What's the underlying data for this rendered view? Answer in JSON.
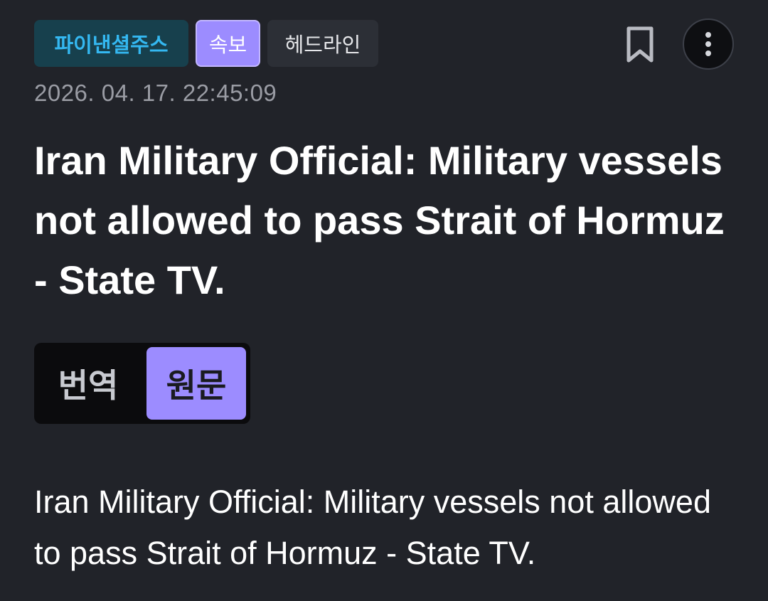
{
  "header": {
    "tags": {
      "source": "파이낸셜주스",
      "breaking": "속보",
      "headline": "헤드라인"
    },
    "icons": [
      "bookmark-icon",
      "more-vertical-icon"
    ]
  },
  "article": {
    "timestamp": "2026. 04. 17. 22:45:09",
    "title": "Iran Military Official: Military vessels not allowed to pass Strait of Hormuz - State TV.",
    "body": "Iran Military Official: Military vessels not allowed to pass Strait of Hormuz - State TV."
  },
  "toggle": {
    "translate_label": "번역",
    "original_label": "원문",
    "selected": "원문"
  },
  "colors": {
    "background": "#212329",
    "accent": "#9c8cff",
    "source_tag_text": "#34b8f1"
  }
}
